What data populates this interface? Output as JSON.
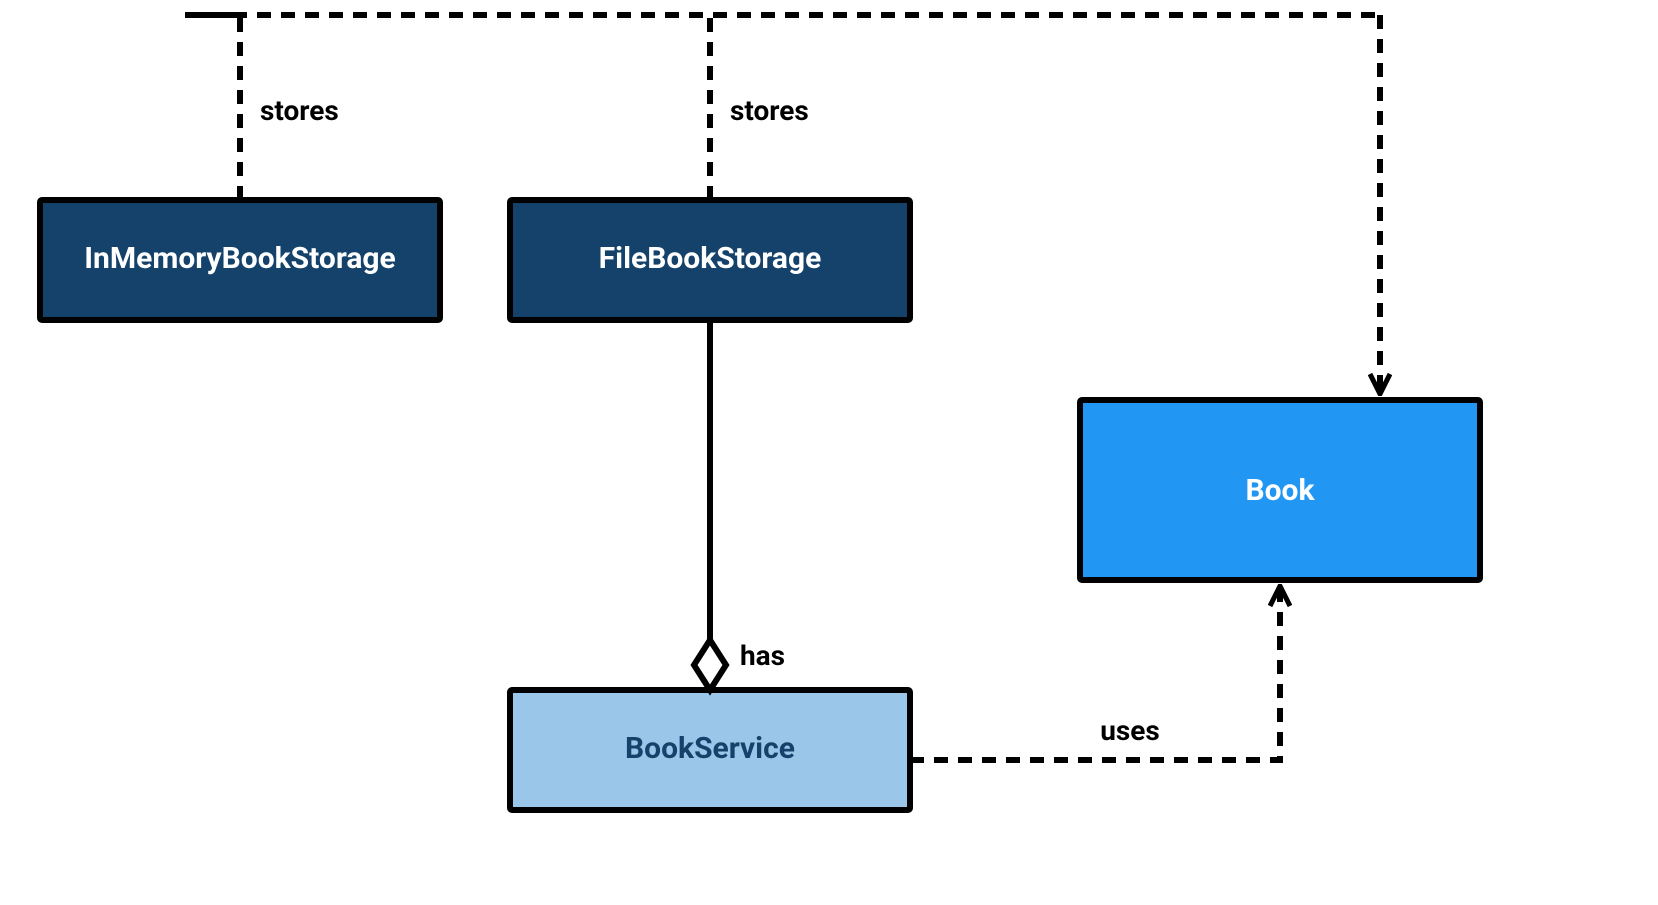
{
  "nodes": {
    "inMemory": {
      "label": "InMemoryBookStorage",
      "fill": "#14426a",
      "text": "#ffffff"
    },
    "fileStore": {
      "label": "FileBookStorage",
      "fill": "#14426a",
      "text": "#ffffff"
    },
    "bookSvc": {
      "label": "BookService",
      "fill": "#9ac6ea",
      "text": "#14426a"
    },
    "book": {
      "label": "Book",
      "fill": "#2196f3",
      "text": "#ffffff"
    }
  },
  "edges": {
    "storesLeft": {
      "label": "stores"
    },
    "storesRight": {
      "label": "stores"
    },
    "has": {
      "label": "has"
    },
    "uses": {
      "label": "uses"
    }
  }
}
